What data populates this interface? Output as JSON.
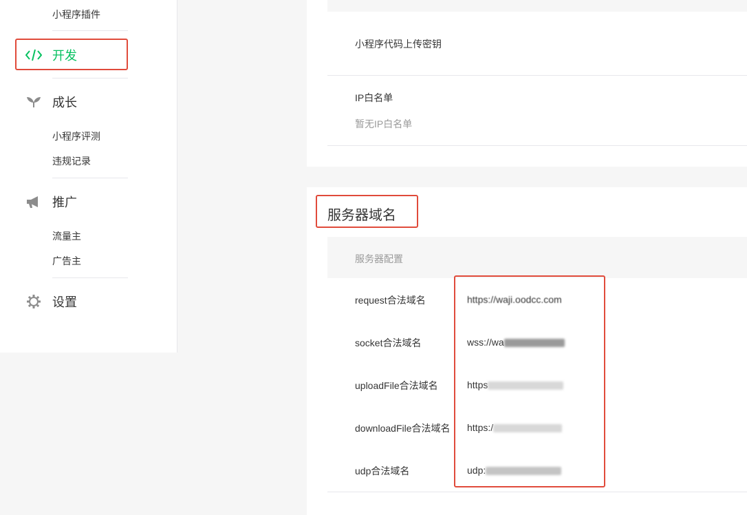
{
  "sidebar": {
    "top_item": "小程序插件",
    "dev": {
      "label": "开发",
      "icon": "code-icon",
      "color": "#07c160"
    },
    "growth": {
      "label": "成长",
      "icon": "sprout-icon",
      "items": [
        "小程序评测",
        "违规记录"
      ]
    },
    "promo": {
      "label": "推广",
      "icon": "megaphone-icon",
      "items": [
        "流量主",
        "广告主"
      ]
    },
    "settings": {
      "label": "设置",
      "icon": "gear-icon"
    }
  },
  "panel_top": {
    "secret_label": "小程序代码上传密钥",
    "ip_label": "IP白名单",
    "ip_empty": "暂无IP白名单"
  },
  "server_domains": {
    "title": "服务器域名",
    "config_header": "服务器配置",
    "rows": [
      {
        "label": "request合法域名",
        "value_prefix": "https://waji.oodcc.com"
      },
      {
        "label": "socket合法域名",
        "value_prefix": "wss://wa"
      },
      {
        "label": "uploadFile合法域名",
        "value_prefix": "https"
      },
      {
        "label": "downloadFile合法域名",
        "value_prefix": "https:/"
      },
      {
        "label": "udp合法域名",
        "value_prefix": "udp:"
      }
    ]
  },
  "colors": {
    "highlight": "#e04a3a",
    "accent": "#07c160"
  }
}
